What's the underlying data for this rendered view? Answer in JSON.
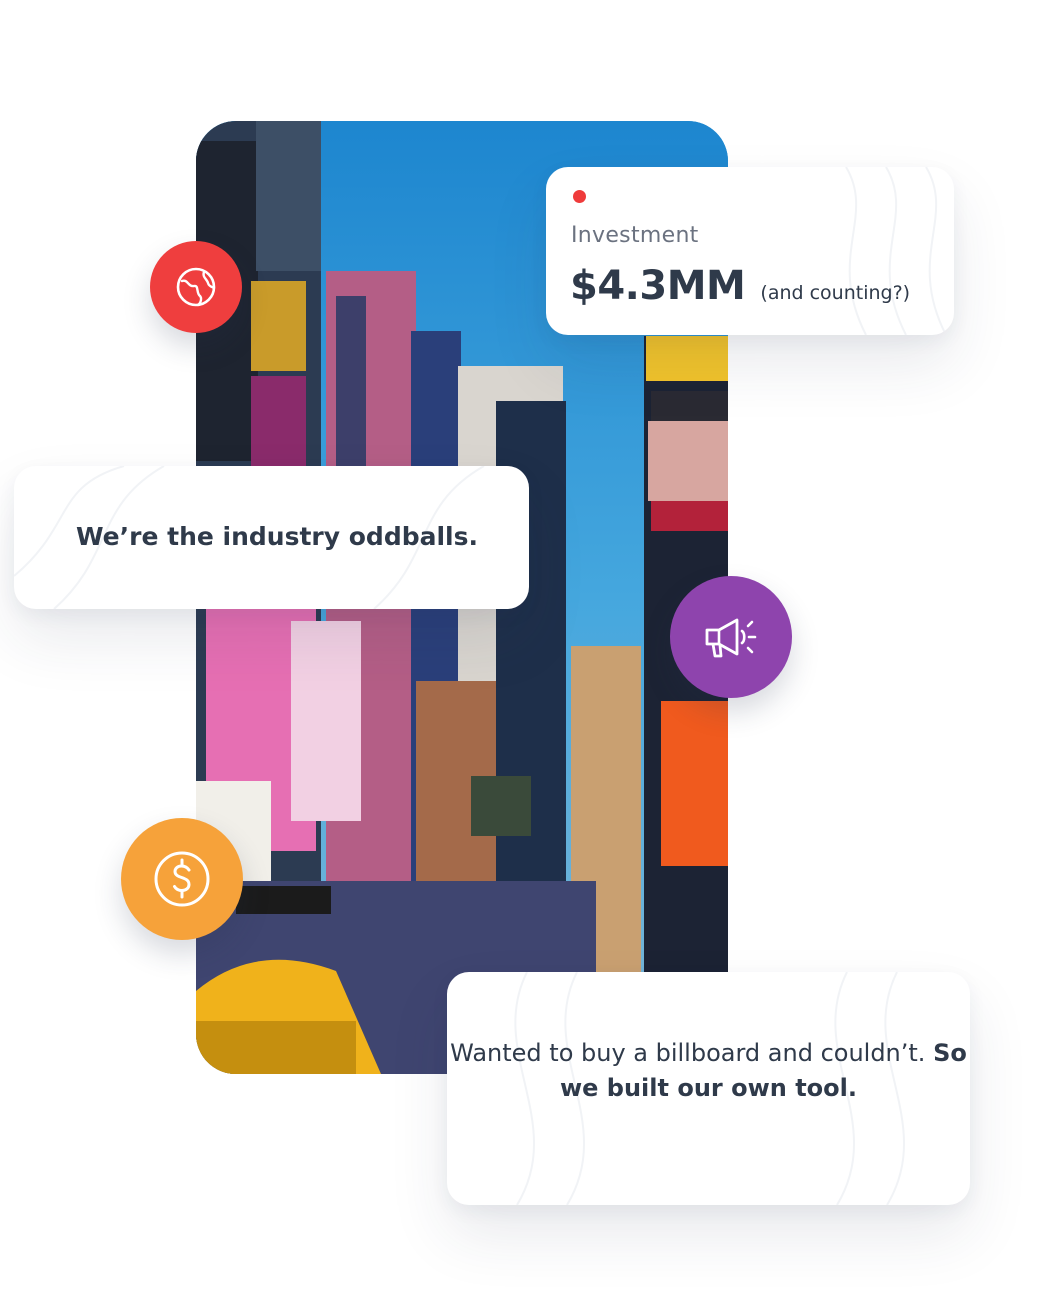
{
  "investment": {
    "label": "Investment",
    "value": "$4.3MM",
    "note": "(and counting?)",
    "dot_color": "#ef3b3b"
  },
  "oddballs": {
    "text": "We’re the industry oddballs."
  },
  "billboard": {
    "text_regular": "Wanted to buy a billboard and couldn’t. ",
    "text_bold": "So we built our own tool."
  },
  "icons": {
    "globe": {
      "name": "globe-icon",
      "color": "#ef3e3e"
    },
    "megaphone": {
      "name": "megaphone-icon",
      "color": "#8e44ad"
    },
    "dollar": {
      "name": "dollar-icon",
      "color": "#f6a23a"
    }
  },
  "photo": {
    "subject": "city street with billboards"
  }
}
